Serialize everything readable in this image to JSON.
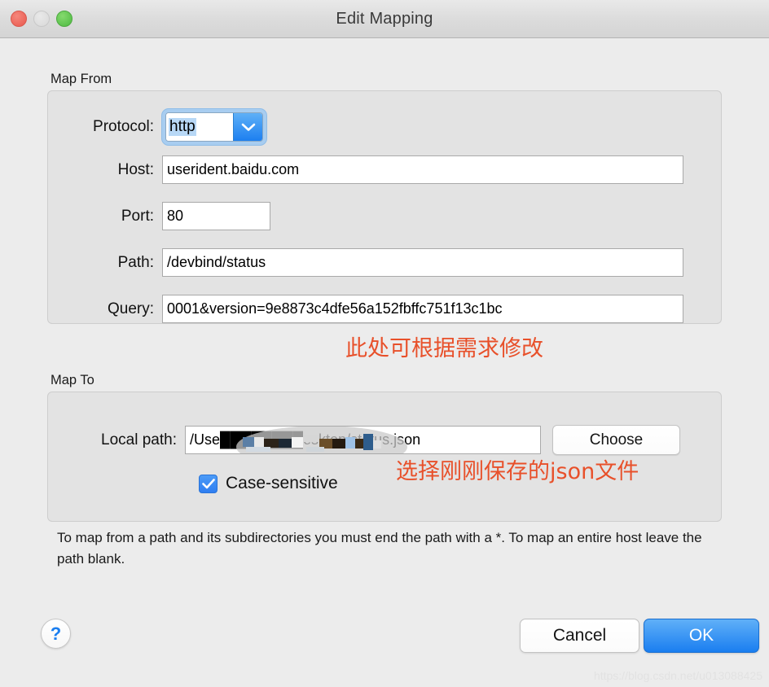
{
  "window": {
    "title": "Edit Mapping",
    "traffic_lights": [
      {
        "name": "close",
        "color": "#ec6459"
      },
      {
        "name": "minimize",
        "color": "#dcdcdc"
      },
      {
        "name": "zoom",
        "color": "#5bc14c"
      }
    ]
  },
  "map_from": {
    "legend": "Map From",
    "protocol": {
      "label": "Protocol:",
      "value": "http",
      "dropdown_icon": "chevron-down-icon"
    },
    "host": {
      "label": "Host:",
      "value": "userident.baidu.com"
    },
    "port": {
      "label": "Port:",
      "value": "80"
    },
    "path": {
      "label": "Path:",
      "value": "/devbind/status"
    },
    "query": {
      "label": "Query:",
      "value": "0001&version=9e8873c4dfe56a152fbffc751f13c1bc"
    }
  },
  "map_to": {
    "legend": "Map To",
    "local_path": {
      "label": "Local path:",
      "value": "/Use████████esktop/status.json"
    },
    "choose_button": "Choose",
    "case_sensitive": {
      "label": "Case-sensitive",
      "checked": true
    }
  },
  "annotations": [
    {
      "name": "query-annotation",
      "text": "此处可根据需求修改",
      "color": "#e8502a"
    },
    {
      "name": "localpath-annotation",
      "text": "选择刚刚保存的json文件",
      "color": "#e8502a"
    }
  ],
  "help_text": "To map from a path and its subdirectories you must end the path with a *. To map an entire host leave the path blank.",
  "footer": {
    "help_button": "?",
    "cancel_button": "Cancel",
    "ok_button": "OK"
  },
  "watermark": "https://blog.csdn.net/u013088425"
}
